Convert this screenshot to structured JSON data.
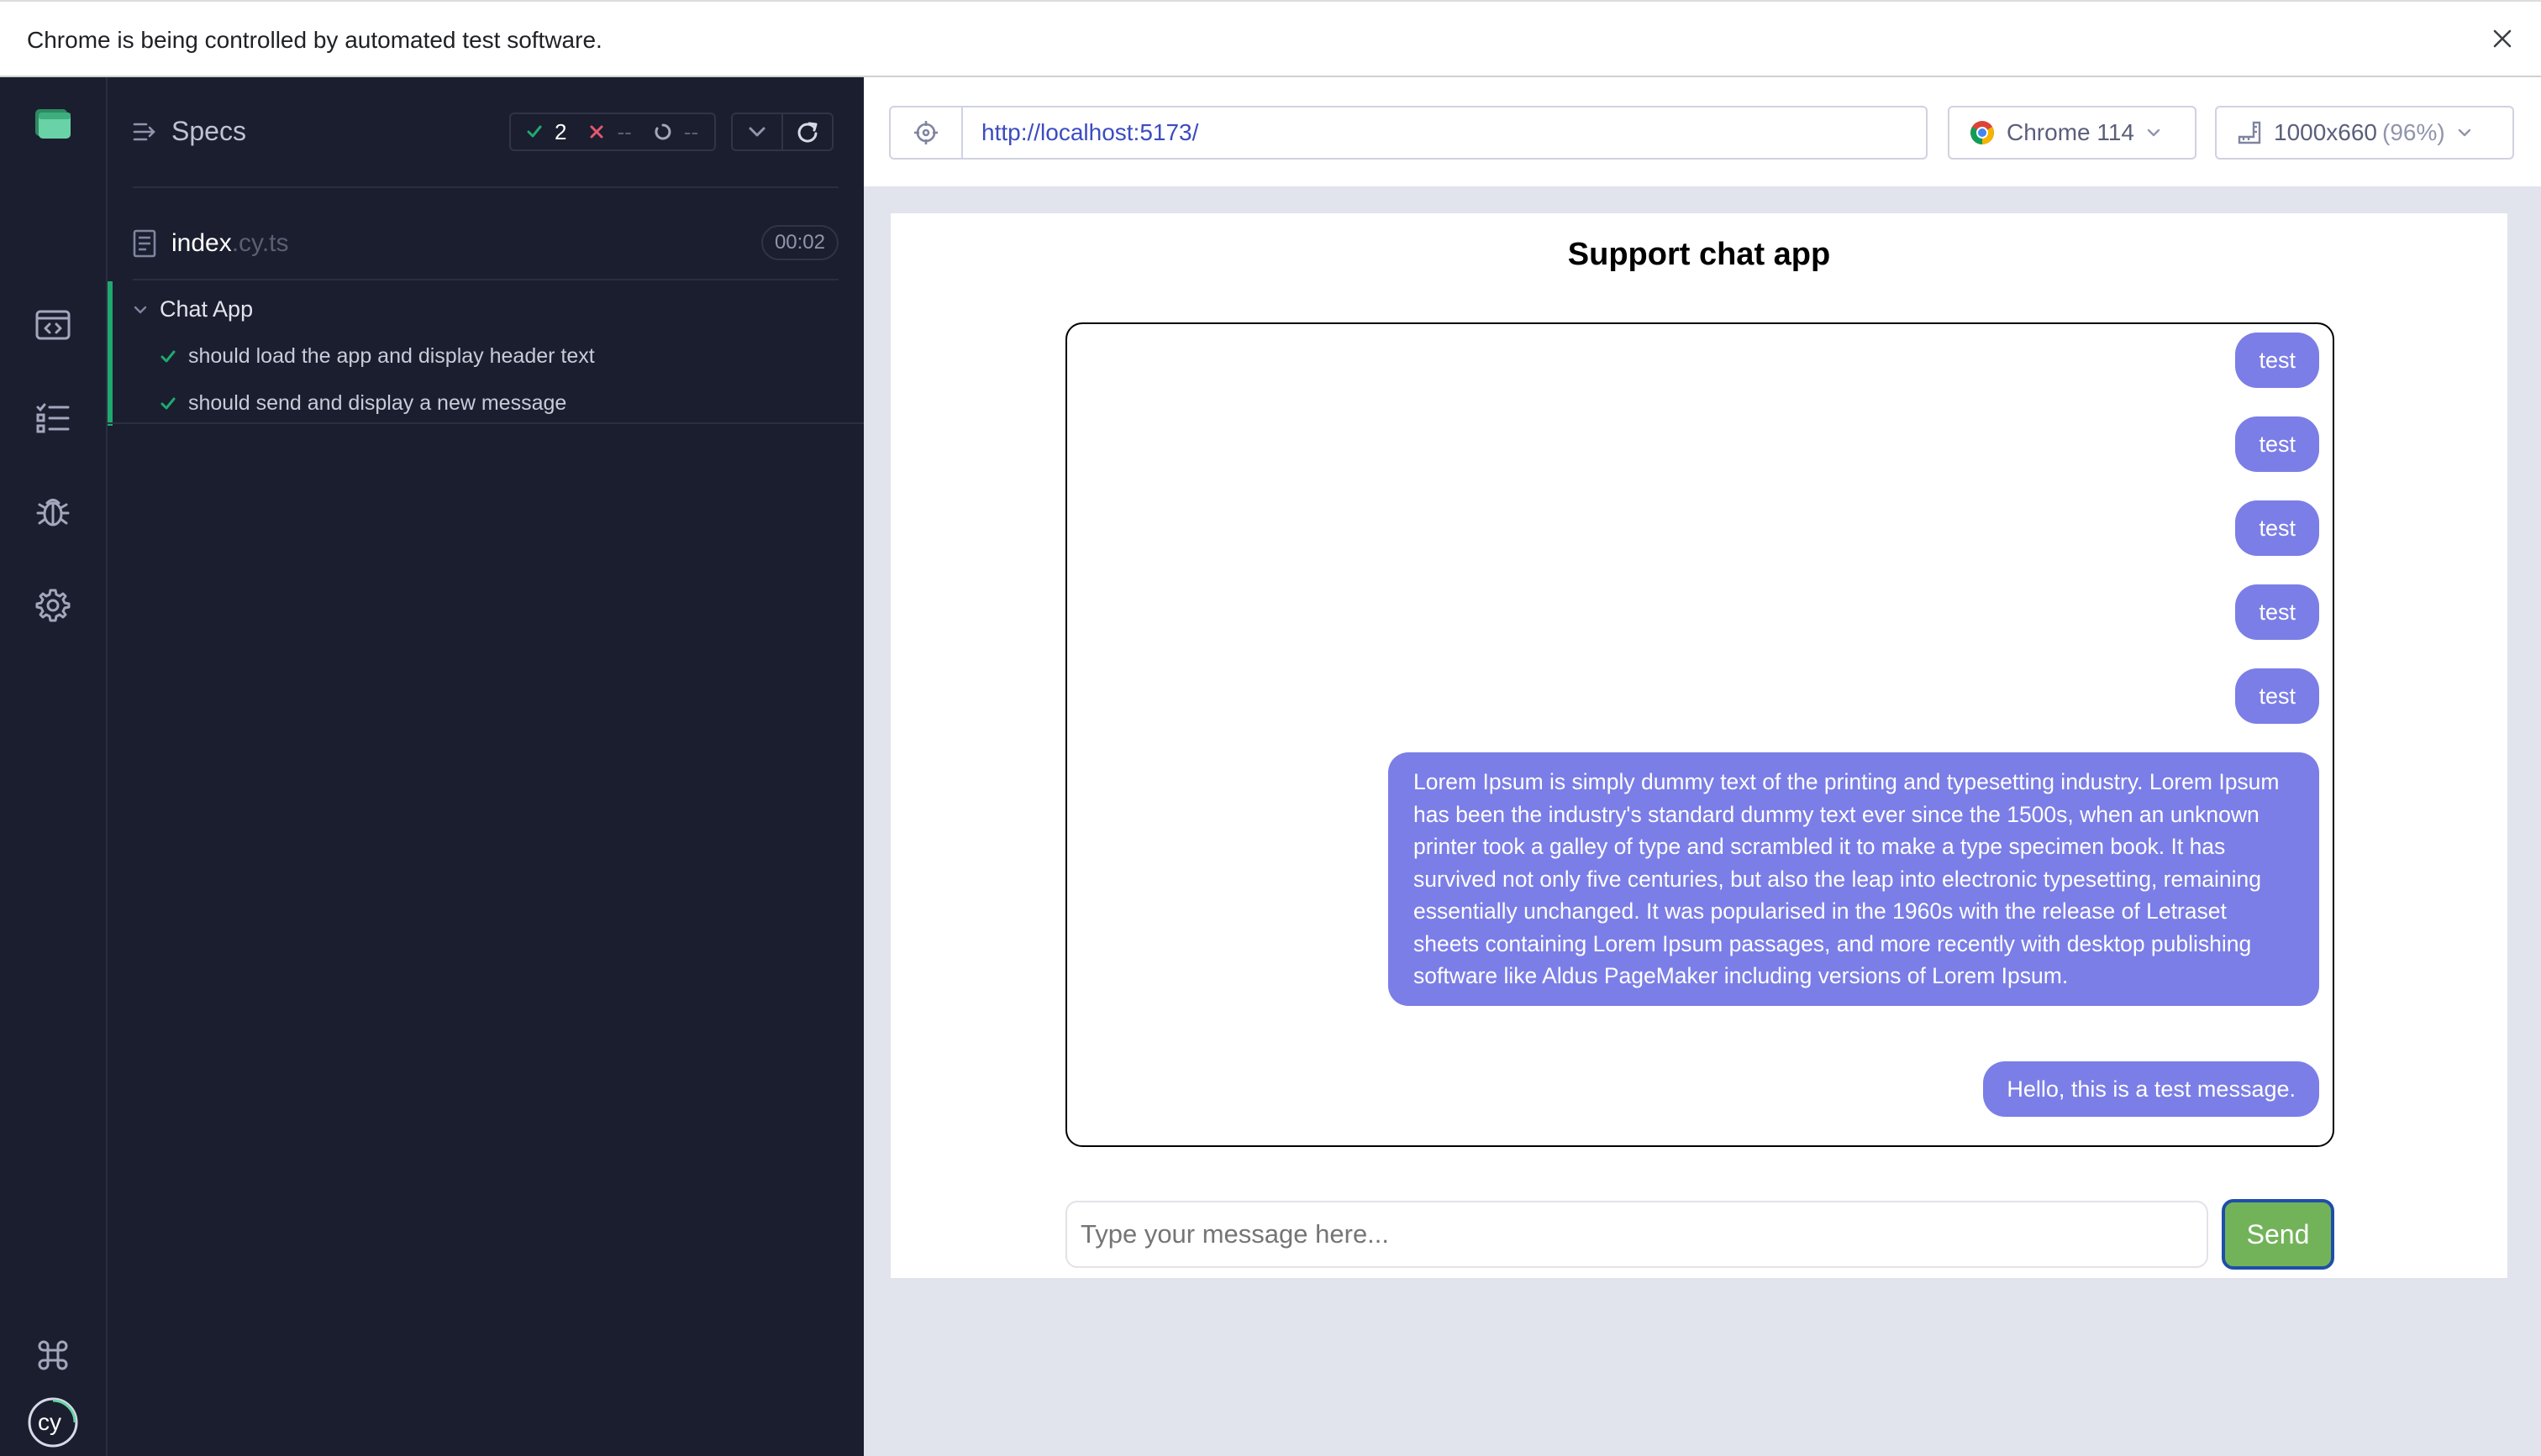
{
  "infobar": {
    "message": "Chrome is being controlled by automated test software.",
    "close_icon": "close-icon"
  },
  "nav": {
    "items": [
      "cypress-app-icon",
      "code-window-icon",
      "test-list-icon",
      "bug-icon",
      "gear-icon",
      "command-key-icon",
      "cypress-logo-icon"
    ]
  },
  "reporter": {
    "title": "Specs",
    "stats": {
      "passed": "2",
      "failed": "--",
      "pending": "--"
    },
    "spec": {
      "name": "index",
      "ext": ".cy.ts",
      "duration": "00:02"
    },
    "suite": {
      "title": "Chat App",
      "tests": [
        {
          "title": "should load the app and display header text",
          "status": "passed"
        },
        {
          "title": "should send and display a new message",
          "status": "passed"
        }
      ]
    }
  },
  "aut": {
    "url": "http://localhost:5173/",
    "browser": "Chrome 114",
    "viewport_size": "1000x660",
    "viewport_scale": "(96%)"
  },
  "chat_app": {
    "title": "Support chat app",
    "messages": [
      "test",
      "test",
      "test",
      "test",
      "test",
      "Lorem Ipsum is simply dummy text of the printing and typesetting industry. Lorem Ipsum has been the industry's standard dummy text ever since the 1500s, when an unknown printer took a galley of type and scrambled it to make a type specimen book. It has survived not only five centuries, but also the leap into electronic typesetting, remaining essentially unchanged. It was popularised in the 1960s with the release of Letraset sheets containing Lorem Ipsum passages, and more recently with desktop publishing software like Aldus PageMaker including versions of Lorem Ipsum.",
      "Hello, this is a test message."
    ],
    "input_placeholder": "Type your message here...",
    "send_label": "Send"
  },
  "colors": {
    "sidebar_bg": "#1b1e2e",
    "pass_green": "#1fa971",
    "fail_red": "#e45770",
    "bubble": "#7b7ee6",
    "send_button": "#72b35a"
  }
}
